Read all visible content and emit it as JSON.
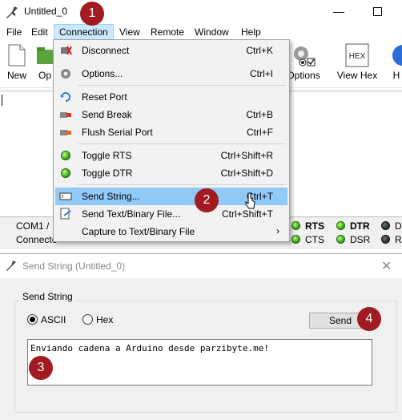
{
  "window": {
    "title": "Untitled_0",
    "minimize_glyph": "—"
  },
  "menubar": {
    "items": [
      "File",
      "Edit",
      "Connection",
      "View",
      "Remote",
      "Window",
      "Help"
    ],
    "active": "Connection"
  },
  "toolbar": {
    "new_label": "New",
    "open_label_partial": "Op",
    "options_label": "Options",
    "view_hex_label": "View Hex",
    "hex_icon_text": "HEX",
    "help_label_partial": "H"
  },
  "statusbar": {
    "port_text": "COM1 / ",
    "connect_text": "Connecte",
    "leds": [
      {
        "label": "RTS",
        "bold": true,
        "color": "green"
      },
      {
        "label": "DTR",
        "bold": true,
        "color": "green"
      },
      {
        "label": "D",
        "bold": false,
        "color": "dark"
      },
      {
        "label": "CTS",
        "bold": false,
        "color": "green"
      },
      {
        "label": "DSR",
        "bold": false,
        "color": "green"
      },
      {
        "label": "R",
        "bold": false,
        "color": "dark"
      }
    ]
  },
  "dropdown": {
    "items": [
      {
        "label": "Disconnect",
        "shortcut": "Ctrl+K",
        "icon": "disconnect-icon"
      },
      {
        "label": "Options...",
        "shortcut": "Ctrl+I",
        "icon": "gear-icon"
      },
      {
        "label": "Reset Port",
        "shortcut": "",
        "icon": "reset-icon"
      },
      {
        "label": "Send Break",
        "shortcut": "Ctrl+B",
        "icon": "break-icon"
      },
      {
        "label": "Flush Serial Port",
        "shortcut": "Ctrl+F",
        "icon": "flush-icon"
      },
      {
        "label": "Toggle RTS",
        "shortcut": "Ctrl+Shift+R",
        "icon": "green-led-icon"
      },
      {
        "label": "Toggle DTR",
        "shortcut": "Ctrl+Shift+D",
        "icon": "green-led-icon"
      },
      {
        "label": "Send String...",
        "shortcut": "Ctrl+T",
        "icon": "send-string-icon"
      },
      {
        "label": "Send Text/Binary File...",
        "shortcut": "Ctrl+Shift+T",
        "icon": "send-file-icon"
      },
      {
        "label": "Capture to Text/Binary File",
        "shortcut": "",
        "icon": "",
        "submenu_arrow": "›"
      }
    ]
  },
  "dialog": {
    "title": "Send String (Untitled_0)",
    "close_glyph": "✕",
    "group_title": "Send String",
    "radio_ascii": "ASCII",
    "radio_hex": "Hex",
    "selected_mode": "ASCII",
    "send_button": "Send",
    "input_value": "Enviando cadena a Arduino desde parzibyte.me!"
  },
  "badges": [
    "1",
    "2",
    "3",
    "4"
  ],
  "colors": {
    "badge": "#a11b20",
    "menu_highlight": "#91c9f7",
    "active_menu": "#cce8ff"
  }
}
